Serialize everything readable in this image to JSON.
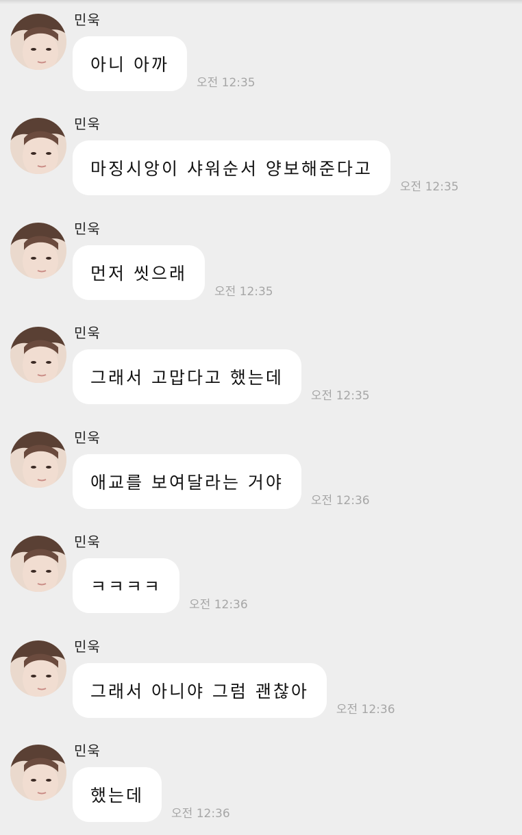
{
  "messages": [
    {
      "sender": "민욱",
      "text": "아니 아까",
      "time": "오전 12:35"
    },
    {
      "sender": "민욱",
      "text": "마징시앙이 샤워순서 양보해준다고",
      "time": "오전 12:35"
    },
    {
      "sender": "민욱",
      "text": "먼저 씻으래",
      "time": "오전 12:35"
    },
    {
      "sender": "민욱",
      "text": "그래서 고맙다고 했는데",
      "time": "오전 12:35"
    },
    {
      "sender": "민욱",
      "text": "애교를 보여달라는 거야",
      "time": "오전 12:36"
    },
    {
      "sender": "민욱",
      "text": "ㅋㅋㅋㅋ",
      "time": "오전 12:36"
    },
    {
      "sender": "민욱",
      "text": "그래서 아니야 그럼 괜찮아",
      "time": "오전 12:36"
    },
    {
      "sender": "민욱",
      "text": "했는데",
      "time": "오전 12:36"
    }
  ]
}
